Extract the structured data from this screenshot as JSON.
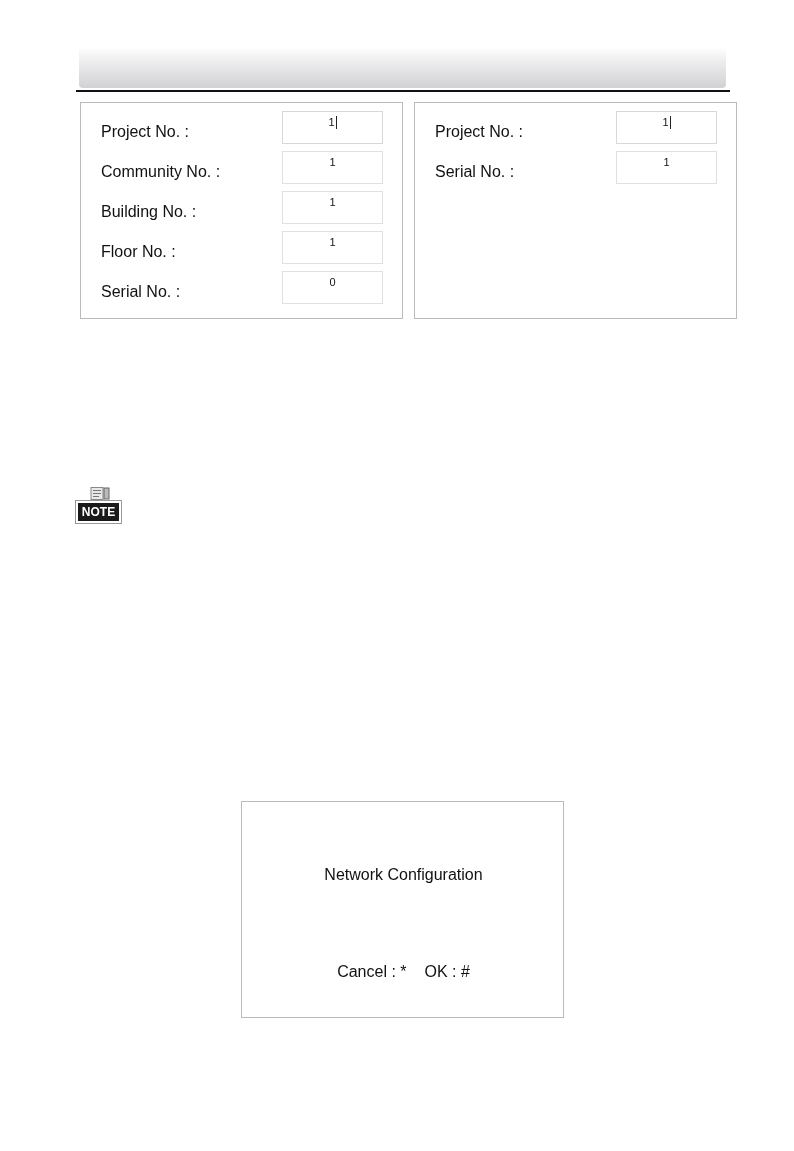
{
  "panels": [
    {
      "fields": [
        {
          "label": "Project No. :",
          "value": "1",
          "focused": true
        },
        {
          "label": "Community No. :",
          "value": "1",
          "focused": false
        },
        {
          "label": "Building No. :",
          "value": "1",
          "focused": false
        },
        {
          "label": "Floor No. :",
          "value": "1",
          "focused": false
        },
        {
          "label": "Serial No. :",
          "value": "0",
          "focused": false
        }
      ]
    },
    {
      "fields": [
        {
          "label": "Project No. :",
          "value": "1",
          "focused": true
        },
        {
          "label": "Serial No. :",
          "value": "1",
          "focused": false
        }
      ]
    }
  ],
  "note": {
    "label": "NOTE"
  },
  "dialog": {
    "title": "Network Configuration",
    "hints": [
      "Cancel : *",
      "OK : #"
    ]
  }
}
